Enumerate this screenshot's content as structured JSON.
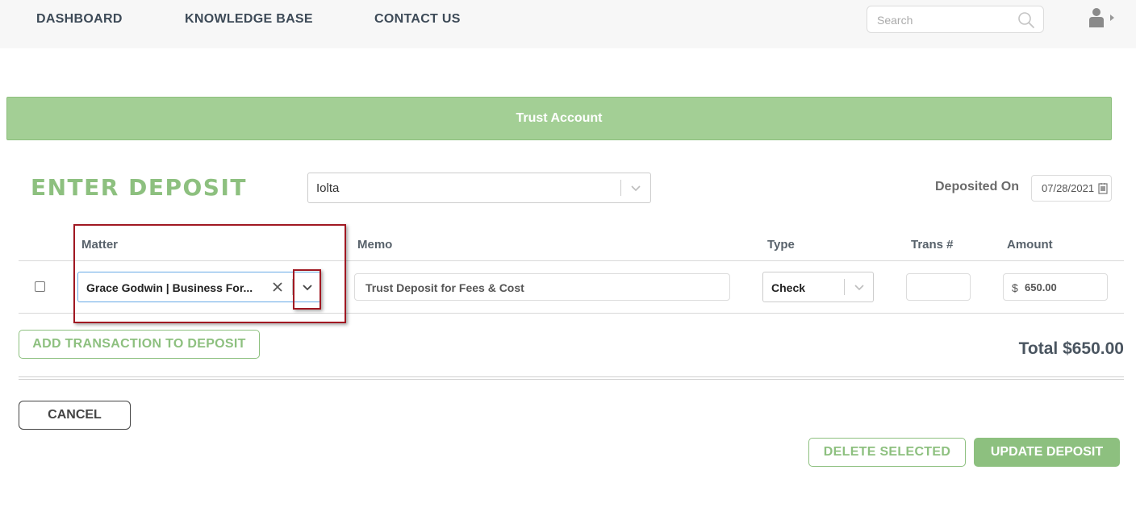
{
  "nav": {
    "links": [
      "DASHBOARD",
      "KNOWLEDGE BASE",
      "CONTACT US"
    ],
    "search_placeholder": "Search"
  },
  "banner": {
    "title": "Trust Account"
  },
  "deposit": {
    "title": "ENTER DEPOSIT",
    "account": "Iolta",
    "deposited_on_label": "Deposited On",
    "deposited_on": "07/28/2021"
  },
  "table": {
    "headers": {
      "matter": "Matter",
      "memo": "Memo",
      "type": "Type",
      "trans": "Trans #",
      "amount": "Amount"
    },
    "rows": [
      {
        "selected": false,
        "matter": "Grace Godwin | Business For...",
        "memo": "Trust Deposit for Fees & Cost",
        "type": "Check",
        "trans": "",
        "currency": "$",
        "amount": "650.00"
      }
    ]
  },
  "actions": {
    "add_transaction": "ADD TRANSACTION TO DEPOSIT",
    "total": "Total $650.00",
    "cancel": "CANCEL",
    "delete_selected": "DELETE SELECTED",
    "update_deposit": "UPDATE DEPOSIT"
  },
  "colors": {
    "accent_green": "#8dc07f",
    "banner_green": "#a3cf95",
    "highlight_red": "#a01822",
    "focus_blue": "#67a9e6"
  },
  "icons": [
    "search-icon",
    "user-icon",
    "chevron-down-icon",
    "calendar-icon",
    "close-icon"
  ]
}
